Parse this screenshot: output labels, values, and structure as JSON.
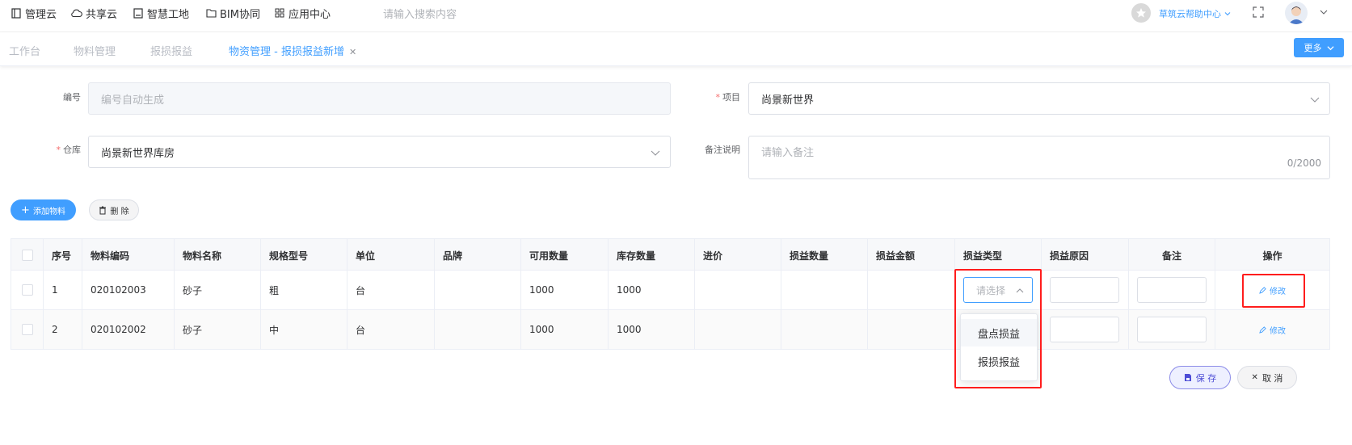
{
  "nav": {
    "items": [
      {
        "label": "管理云",
        "icon": "book-icon"
      },
      {
        "label": "共享云",
        "icon": "cloud-icon"
      },
      {
        "label": "智慧工地",
        "icon": "book-icon"
      },
      {
        "label": "BIM协同",
        "icon": "folder-icon"
      },
      {
        "label": "应用中心",
        "icon": "grid-icon"
      }
    ],
    "search_placeholder": "请输入搜索内容",
    "help_label": "草筑云帮助中心"
  },
  "tabs": [
    {
      "label": "工作台"
    },
    {
      "label": "物料管理"
    },
    {
      "label": "报损报益"
    },
    {
      "label": "物资管理 - 报损报益新增",
      "active": true
    }
  ],
  "more_label": "更多",
  "form": {
    "code": {
      "label": "编号",
      "placeholder": "编号自动生成"
    },
    "project": {
      "label": "项目",
      "value": "尚景新世界"
    },
    "warehouse": {
      "label": "仓库",
      "value": "尚景新世界库房"
    },
    "remark": {
      "label": "备注说明",
      "placeholder": "请输入备注",
      "counter": "0/2000"
    }
  },
  "actions": {
    "add_label": "添加物料",
    "delete_label": "删 除"
  },
  "table": {
    "headers": [
      "序号",
      "物料编码",
      "物料名称",
      "规格型号",
      "单位",
      "品牌",
      "可用数量",
      "库存数量",
      "进价",
      "损益数量",
      "损益金额",
      "损益类型",
      "损益原因",
      "备注",
      "操作"
    ],
    "rows": [
      {
        "no": "1",
        "code": "020102003",
        "name": "砂子",
        "spec": "粗",
        "unit": "台",
        "brand": "",
        "available": "1000",
        "stock": "1000",
        "price": "",
        "qty": "",
        "amount": "",
        "action": "修改"
      },
      {
        "no": "2",
        "code": "020102002",
        "name": "砂子",
        "spec": "中",
        "unit": "台",
        "brand": "",
        "available": "1000",
        "stock": "1000",
        "price": "",
        "qty": "",
        "amount": "",
        "action": "修改"
      }
    ],
    "type_select_placeholder": "请选择"
  },
  "dropdown": {
    "options": [
      "盘点损益",
      "报损报益"
    ]
  },
  "footer": {
    "save_label": "保 存",
    "cancel_label": "取 消"
  },
  "colors": {
    "primary": "#409eff",
    "highlight": "#ff1d1d"
  }
}
